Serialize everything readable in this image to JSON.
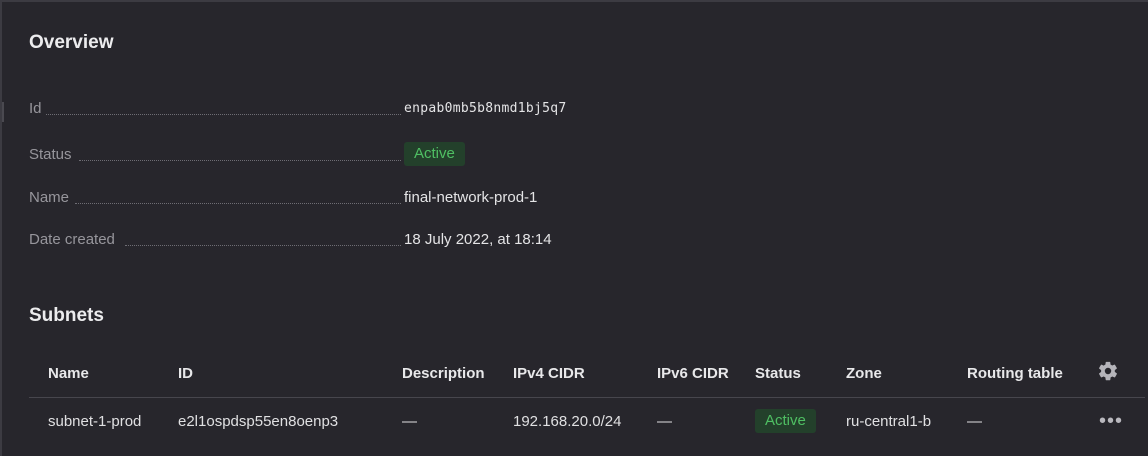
{
  "overview": {
    "title": "Overview",
    "id_label": "Id",
    "id_value": "enpab0mb5b8nmd1bj5q7",
    "status_label": "Status",
    "status_value": "Active",
    "name_label": "Name",
    "name_value": "final-network-prod-1",
    "date_label": "Date created",
    "date_value": "18 July 2022, at 18:14"
  },
  "subnets": {
    "title": "Subnets",
    "columns": {
      "name": "Name",
      "id": "ID",
      "description": "Description",
      "ipv4": "IPv4 CIDR",
      "ipv6": "IPv6 CIDR",
      "status": "Status",
      "zone": "Zone",
      "routing_table": "Routing table"
    },
    "settings_icon": "gear-icon",
    "rows": [
      {
        "name": "subnet-1-prod",
        "id": "e2l1ospdsp55en8oenp3",
        "description": "—",
        "ipv4": "192.168.20.0/24",
        "ipv6": "—",
        "status": "Active",
        "zone": "ru-central1-b",
        "routing_table": "—",
        "actions_icon": "more-horizontal-icon"
      }
    ]
  },
  "colors": {
    "background": "#27262c",
    "status_active_text": "#4fbf63",
    "status_active_bg": "#23402b"
  }
}
